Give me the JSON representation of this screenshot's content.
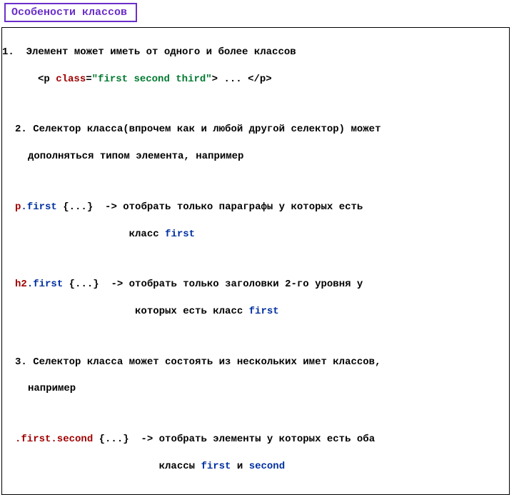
{
  "title": "Особености классов",
  "lines": {
    "l1": "1.  Элемент может иметь от одного и более классов",
    "tag_open": "<p ",
    "attr_name": "class",
    "attr_eq": "=",
    "attr_val": "\"first second third\"",
    "tag_close": "> ... </p>",
    "l2a": "2. Селектор класса(впрочем как и любой другой селектор) может",
    "l2b": "дополняться типом элемента, например",
    "sel_p": "p",
    "sel_dotfirst": ".first",
    "sel_braces": " {...}  -> ",
    "sel_p_desc_a": "отобрать только параграфы у которых есть",
    "sel_p_desc_b": "                   класс ",
    "sel_h2": "h2",
    "sel_h2_desc_a": "отобрать только заголовки 2-го уровня у",
    "sel_h2_desc_b": "                    которых есть класс ",
    "l3a": "3. Селектор класса может состоять из нескольких имет классов,",
    "l3b": "например",
    "sel_fs": ".first.second",
    "sel_fs_desc_a": "отобрать элементы у которых есть оба",
    "sel_fs_desc_b": "                        классы ",
    "w_first": "first",
    "w_and": " и ",
    "w_second": "second"
  }
}
